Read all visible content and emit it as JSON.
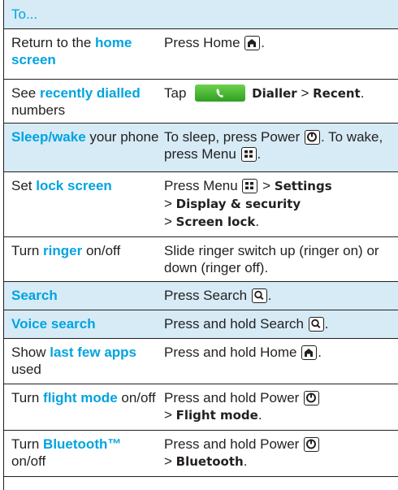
{
  "header": {
    "label": "To..."
  },
  "rows": [
    {
      "c1_pre": "Return to the ",
      "c1_hl": "home screen",
      "c2_text": "Press Home ",
      "c2_key_icon": "home-key-icon",
      "c2_post": "."
    },
    {
      "c1_pre": "See ",
      "c1_hl": "recently dialled",
      "c1_post": " numbers",
      "c2_pre": "Tap ",
      "c2_btn_icon": "phone-icon",
      "c2_b1": "Dialler",
      "c2_sep": " > ",
      "c2_b2": "Recent",
      "c2_post": "."
    },
    {
      "c1_hl": "Sleep/wake",
      "c1_post": " your phone",
      "c2_a": "To sleep, press Power ",
      "c2_b": ". To wake, press Menu ",
      "c2_post": "."
    },
    {
      "c1_pre": "Set ",
      "c1_hl": "lock screen",
      "c2_a": "Press Menu ",
      "c2_sep": " > ",
      "c2_b1": "Settings",
      "c2_b2": "Display & security",
      "c2_b3": "Screen lock",
      "c2_post": "."
    },
    {
      "c1_pre": "Turn ",
      "c1_hl": "ringer",
      "c1_post": " on/off",
      "c2_text": "Slide ringer switch up (ringer on) or down (ringer off)."
    },
    {
      "c1_hl": "Search",
      "c2_text": "Press Search ",
      "c2_post": "."
    },
    {
      "c1_hl": "Voice search",
      "c2_text": "Press and hold Search ",
      "c2_post": "."
    },
    {
      "c1_pre": "Show ",
      "c1_hl": "last few apps",
      "c1_post": " used",
      "c2_text": "Press and hold Home ",
      "c2_post": "."
    },
    {
      "c1_pre": "Turn ",
      "c1_hl": "flight mode",
      "c1_post": " on/off",
      "c2_text": "Press and hold Power ",
      "c2_sep": "> ",
      "c2_b1": "Flight mode",
      "c2_post": "."
    },
    {
      "c1_pre": "Turn ",
      "c1_hl": "Bluetooth™",
      "c1_post": " on/off",
      "c2_text": "Press and hold Power ",
      "c2_sep": "> ",
      "c2_b1": "Bluetooth",
      "c2_post": "."
    }
  ],
  "colors": {
    "highlight": "#00a3e0",
    "header_bg": "#d6ebf6",
    "text": "#231f20",
    "dial_green": "#3fb42c"
  }
}
